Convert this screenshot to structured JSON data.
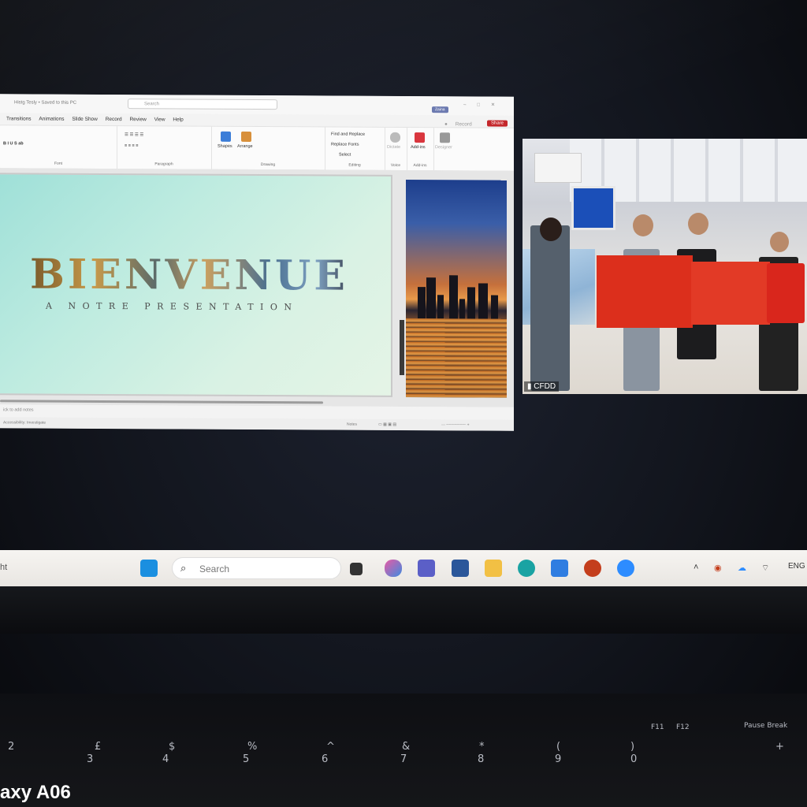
{
  "powerpoint": {
    "search_placeholder": "Search",
    "menu": [
      "Transitions",
      "Animations",
      "Slide Show",
      "Record",
      "Review",
      "View",
      "Help"
    ],
    "record_label": "Record",
    "share_label": "Share",
    "ribbon": {
      "groups": [
        "Font",
        "Paragraph",
        "Drawing",
        "Editing",
        "Voice",
        "Add-ins"
      ],
      "shapes": "Shapes",
      "arrange": "Arrange",
      "find_replace": "Find and Replace",
      "replace_fonts": "Replace Fonts",
      "select": "Select",
      "dictate": "Dictate",
      "addins": "Add-ins",
      "designer": "Designer"
    },
    "slide": {
      "title": "BIENVENUE",
      "subtitle": "A NOTRE PRESENTATION"
    },
    "notes_placeholder": "ick to add notes",
    "status_left": "Accessibility: Investigate",
    "status_right": "Notes"
  },
  "video": {
    "participant": "CFDD"
  },
  "taskbar": {
    "search_placeholder": "Search",
    "language": "ENG",
    "left_edge_text": "ht",
    "colors": {
      "windows": "#1b8fe0",
      "teams": "#5b5fc7",
      "word": "#2b579a",
      "explorer": "#f2c044",
      "edge": "#1aa3a3",
      "store": "#2f7de1",
      "powerpoint": "#c43e1c",
      "zoom": "#2d8cff"
    }
  },
  "keyboard": {
    "fkeys": [
      "F11",
      "F12",
      "Pause Break"
    ],
    "numbers": [
      "2",
      "3",
      "4",
      "5",
      "6",
      "7",
      "8",
      "9",
      "0"
    ],
    "symbols": [
      "£",
      "$",
      "%",
      "^",
      "&",
      "*",
      "(",
      ")",
      "+"
    ]
  },
  "watermark": "axy A06"
}
